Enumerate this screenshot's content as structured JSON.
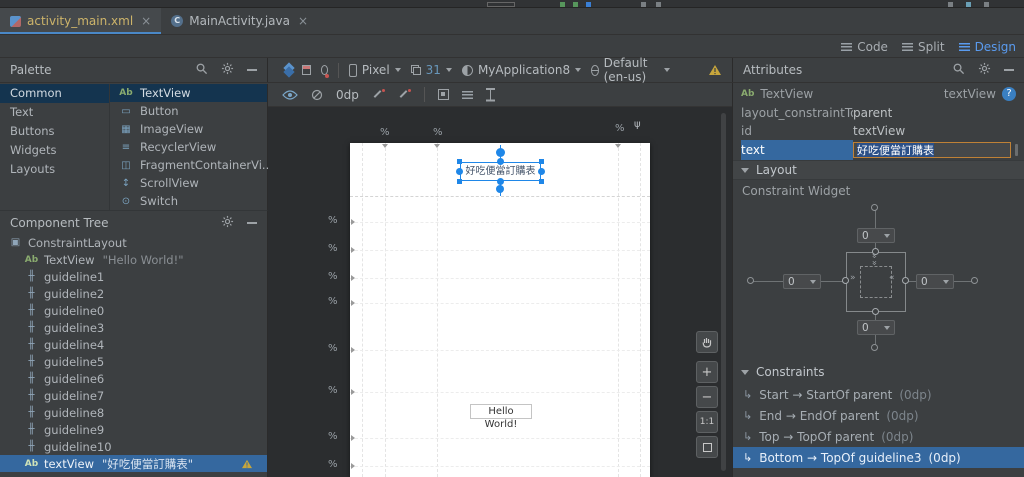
{
  "tabs": {
    "tab1": {
      "label": "activity_main.xml",
      "close": "×"
    },
    "tab2": {
      "label": "MainActivity.java",
      "close": "×",
      "icon": "C"
    }
  },
  "view_modes": {
    "code": "Code",
    "split": "Split",
    "design": "Design"
  },
  "toolbar": {
    "device": "Pixel",
    "api_level": "31",
    "theme": "MyApplication8",
    "locale": "Default (en-us)",
    "default_margin": "0dp"
  },
  "palette": {
    "title": "Palette",
    "categories": [
      {
        "label": "Common"
      },
      {
        "label": "Text"
      },
      {
        "label": "Buttons"
      },
      {
        "label": "Widgets"
      },
      {
        "label": "Layouts"
      }
    ],
    "items": [
      {
        "icon": "Ab",
        "label": "TextView"
      },
      {
        "icon": "▭",
        "label": "Button"
      },
      {
        "icon": "▦",
        "label": "ImageView"
      },
      {
        "icon": "≡",
        "label": "RecyclerView"
      },
      {
        "icon": "◫",
        "label": "FragmentContainerVi..."
      },
      {
        "icon": "↕",
        "label": "ScrollView"
      },
      {
        "icon": "⊙",
        "label": "Switch"
      }
    ]
  },
  "component_tree": {
    "title": "Component Tree",
    "items": [
      {
        "icon": "▣",
        "label": "ConstraintLayout",
        "detail": ""
      },
      {
        "icon": "Ab",
        "label": "TextView",
        "detail": "\"Hello World!\""
      },
      {
        "icon": "╫",
        "label": "guideline1",
        "detail": ""
      },
      {
        "icon": "╫",
        "label": "guideline2",
        "detail": ""
      },
      {
        "icon": "╫",
        "label": "guideline0",
        "detail": ""
      },
      {
        "icon": "╫",
        "label": "guideline3",
        "detail": ""
      },
      {
        "icon": "╫",
        "label": "guideline4",
        "detail": ""
      },
      {
        "icon": "╫",
        "label": "guideline5",
        "detail": ""
      },
      {
        "icon": "╫",
        "label": "guideline6",
        "detail": ""
      },
      {
        "icon": "╫",
        "label": "guideline7",
        "detail": ""
      },
      {
        "icon": "╫",
        "label": "guideline8",
        "detail": ""
      },
      {
        "icon": "╫",
        "label": "guideline9",
        "detail": ""
      },
      {
        "icon": "╫",
        "label": "guideline10",
        "detail": ""
      },
      {
        "icon": "Ab",
        "label": "textView",
        "detail": "\"好吃便當訂購表\""
      }
    ]
  },
  "canvas": {
    "percent": "%",
    "fork_icon": "ψ",
    "selected_widget_text": "好吃便當訂購表",
    "hello_widget_text": "Hello World!",
    "zoom_in": "+",
    "zoom_out": "−",
    "zoom_100": "1:1"
  },
  "attributes": {
    "title": "Attributes",
    "component_icon": "Ab",
    "component_type": "TextView",
    "component_id": "textView",
    "help": "?",
    "properties": [
      {
        "name": "layout_constraintTop",
        "value": "parent"
      },
      {
        "name": "id",
        "value": "textView"
      },
      {
        "name": "text",
        "value": "好吃便當訂購表"
      }
    ],
    "layout_section": "Layout",
    "constraint_widget_label": "Constraint Widget",
    "margins": {
      "top": "0",
      "left": "0",
      "right": "0",
      "bottom": "0"
    },
    "constraints_section": "Constraints",
    "constraints": [
      {
        "icon": "↳",
        "text": "Start → StartOf parent",
        "dp": "(0dp)"
      },
      {
        "icon": "↳",
        "text": "End → EndOf parent",
        "dp": "(0dp)"
      },
      {
        "icon": "↳",
        "text": "Top → TopOf parent",
        "dp": "(0dp)"
      },
      {
        "icon": "↳",
        "text": "Bottom → TopOf guideline3",
        "dp": "(0dp)"
      }
    ]
  }
}
